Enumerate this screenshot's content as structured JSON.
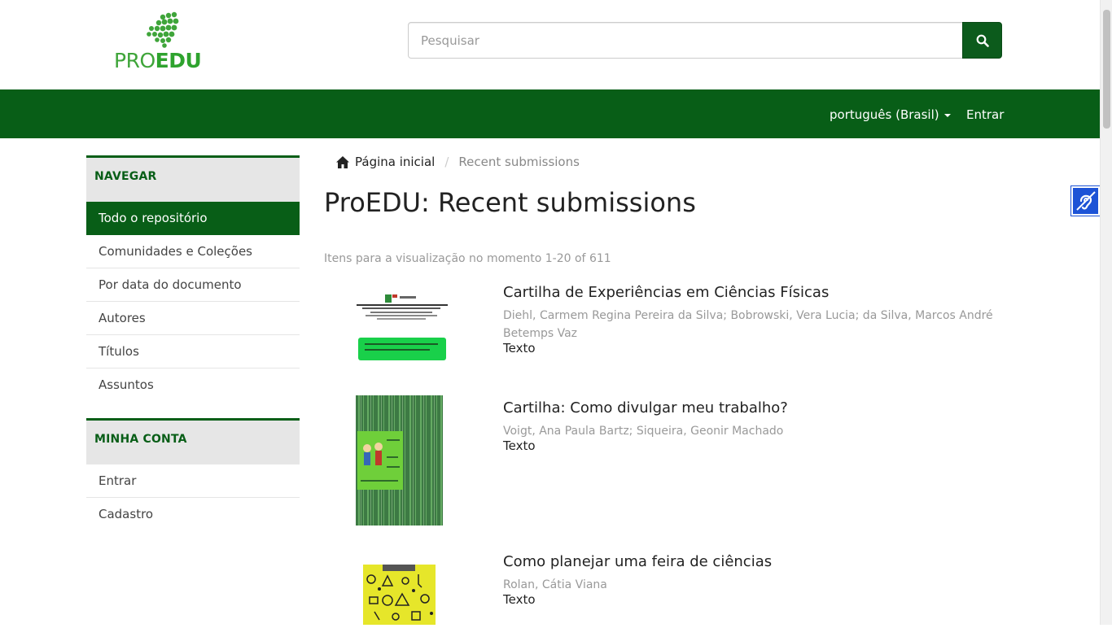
{
  "header": {
    "logo_pro": "PRO",
    "logo_edu": "EDU",
    "search_placeholder": "Pesquisar"
  },
  "navbar": {
    "language": "português (Brasil)",
    "login": "Entrar"
  },
  "sidebar": {
    "browse_heading": "NAVEGAR",
    "browse_items": [
      {
        "label": "Todo o repositório"
      },
      {
        "label": "Comunidades e Coleções"
      },
      {
        "label": "Por data do documento"
      },
      {
        "label": "Autores"
      },
      {
        "label": "Títulos"
      },
      {
        "label": "Assuntos"
      }
    ],
    "account_heading": "MINHA CONTA",
    "account_items": [
      {
        "label": "Entrar"
      },
      {
        "label": "Cadastro"
      }
    ]
  },
  "breadcrumb": {
    "home": "Página inicial",
    "current": "Recent submissions"
  },
  "main": {
    "title": "ProEDU: Recent submissions",
    "count_text": "Itens para a visualização no momento 1-20 of 611",
    "items": [
      {
        "title": "Cartilha de Experiências em Ciências Físicas",
        "authors": "Diehl, Carmem Regina Pereira da Silva; Bobrowski, Vera Lucia; da Silva, Marcos André Betemps Vaz",
        "type": "Texto"
      },
      {
        "title": "Cartilha: Como divulgar meu trabalho?",
        "authors": "Voigt, Ana Paula Bartz; Siqueira, Geonir Machado",
        "type": "Texto"
      },
      {
        "title": "Como planejar uma feira de ciências",
        "authors": "Rolan, Cátia Viana",
        "type": "Texto"
      }
    ]
  },
  "colors": {
    "brand_green": "#085e17",
    "logo_green": "#3fa53a",
    "a11y_blue": "#1d53d6"
  }
}
